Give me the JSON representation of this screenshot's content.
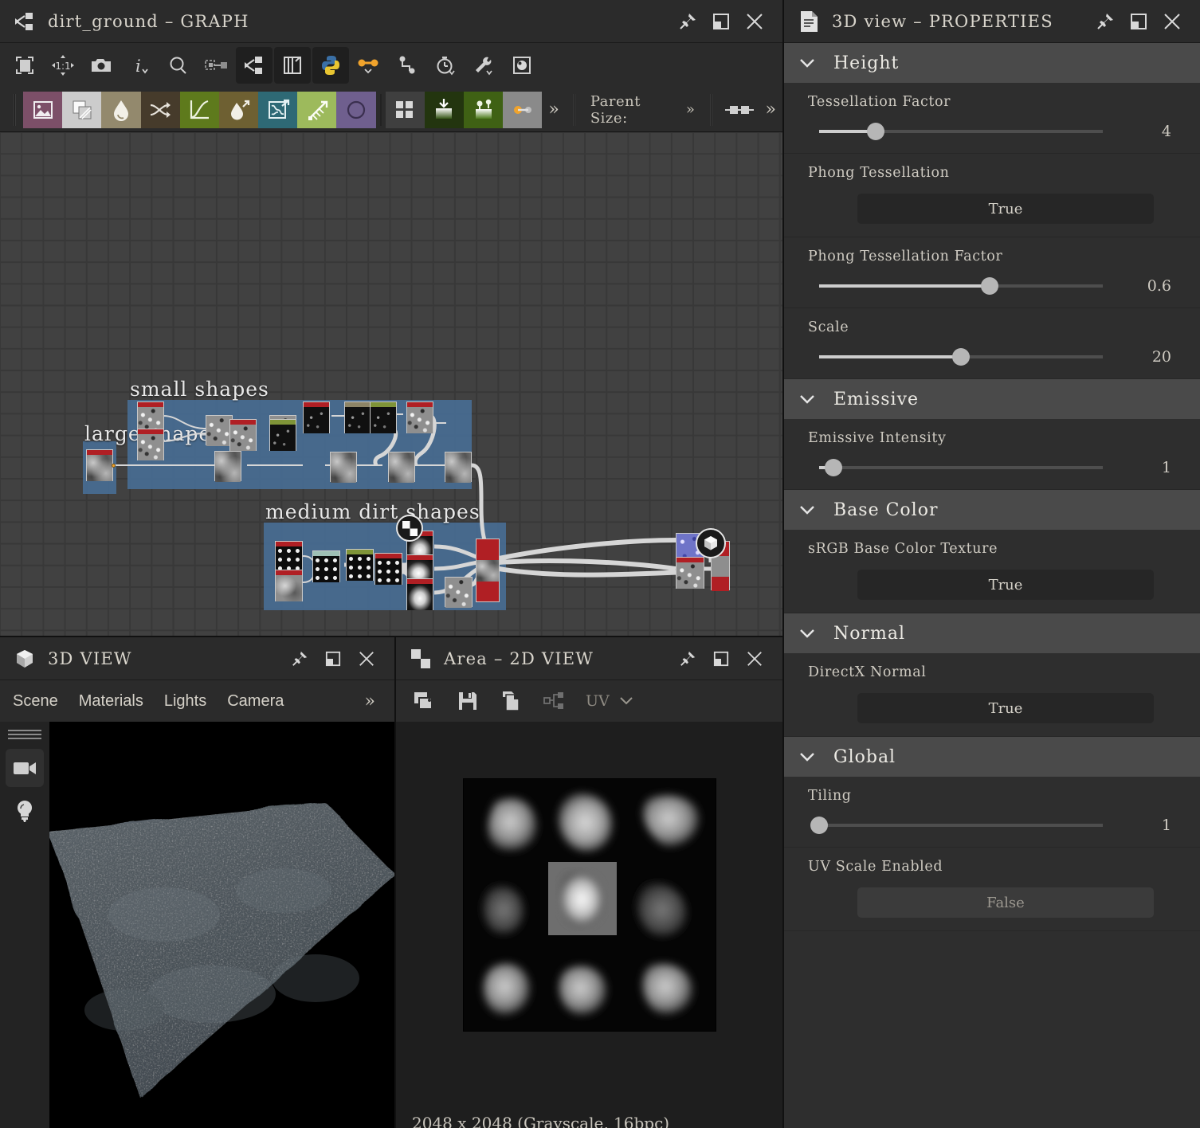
{
  "graph_panel": {
    "title": "dirt_ground – GRAPH",
    "title_icon": "graph-node-icon",
    "window_buttons": [
      "pin-icon",
      "maximize-icon",
      "close-icon"
    ],
    "toolbar_primary": [
      {
        "name": "fit-view-icon",
        "label": "Fit View"
      },
      {
        "name": "zoom-one-to-one-icon",
        "label": "1:1"
      },
      {
        "name": "camera-icon",
        "label": "Screenshot"
      },
      {
        "name": "info-icon",
        "label": "Info"
      },
      {
        "name": "search-icon",
        "label": "Search"
      },
      {
        "name": "link-node-icon",
        "label": "Link"
      },
      {
        "name": "graph-icon",
        "label": "Graph"
      },
      {
        "name": "copy-layers-icon",
        "label": "Layers"
      },
      {
        "name": "python-icon",
        "label": "Python"
      },
      {
        "name": "connection-icon",
        "label": "Connections"
      },
      {
        "name": "path-icon",
        "label": "Path"
      },
      {
        "name": "timer-icon",
        "label": "Timer"
      },
      {
        "name": "wrench-icon",
        "label": "Tools"
      },
      {
        "name": "material-preview-icon",
        "label": "Preview"
      }
    ],
    "toolbar_nodes": [
      {
        "name": "bitmap-node-icon",
        "color": "#7c4f68"
      },
      {
        "name": "blend-node-icon",
        "color": "#cccccc"
      },
      {
        "name": "blur-node-icon",
        "color": "#93896d"
      },
      {
        "name": "shuffle-node-icon",
        "color": "#463b2b"
      },
      {
        "name": "curve-node-icon",
        "color": "#5e7a1c"
      },
      {
        "name": "directional-blur-node-icon",
        "color": "#6e6032"
      },
      {
        "name": "warp-node-icon",
        "color": "#2e6975"
      },
      {
        "name": "gradient-node-icon",
        "color": "#9dba5c"
      },
      {
        "name": "shape-node-icon",
        "color": "#6f5f8e"
      },
      {
        "name": "tile-node-icon",
        "color": "#3f3f3f"
      },
      {
        "name": "input-node-icon",
        "color": "#23350f"
      },
      {
        "name": "output-node-icon",
        "color": "#3f6114"
      },
      {
        "name": "link-creation-node-icon",
        "color": "#8a8a8a"
      }
    ],
    "toolbar_overflow": "»",
    "parent_size_label": "Parent Size:",
    "parent_size_chevron": "»",
    "frames": [
      {
        "name": "small shapes",
        "color": "#486e96"
      },
      {
        "name": "large shapes",
        "color": "#486e96"
      },
      {
        "name": "medium dirt shapes",
        "color": "#486e96"
      }
    ]
  },
  "view3d_panel": {
    "title": "3D VIEW",
    "title_icon": "cube-icon",
    "window_buttons": [
      "pin-icon",
      "maximize-icon",
      "close-icon"
    ],
    "tabs": [
      "Scene",
      "Materials",
      "Lights",
      "Camera"
    ],
    "tabs_overflow": "»",
    "side_tools": [
      {
        "name": "camera-tool-icon",
        "active": true
      },
      {
        "name": "light-tool-icon",
        "active": false
      }
    ]
  },
  "view2d_panel": {
    "title": "Area – 2D VIEW",
    "title_icon": "checker-icon",
    "window_buttons": [
      "pin-icon",
      "maximize-icon",
      "close-icon"
    ],
    "toolbar": [
      {
        "name": "duplicate-view-icon"
      },
      {
        "name": "save-icon"
      },
      {
        "name": "copy-icon"
      },
      {
        "name": "graph-link-icon"
      }
    ],
    "uv_label": "UV",
    "uv_chevron": "chevron-down-icon",
    "status": "2048 x 2048 (Grayscale, 16bpc)"
  },
  "properties_panel": {
    "title": "3D view – PROPERTIES",
    "title_icon": "document-icon",
    "window_buttons": [
      "pin-icon",
      "maximize-icon",
      "close-icon"
    ],
    "groups": [
      {
        "name": "Height",
        "collapse_icon": "chevron-down-icon",
        "rows": [
          {
            "type": "slider",
            "label": "Tessellation Factor",
            "value": "4",
            "percent": 20
          },
          {
            "type": "combo",
            "label": "Phong Tessellation",
            "value": "True",
            "disabled": false
          },
          {
            "type": "slider",
            "label": "Phong Tessellation Factor",
            "value": "0.6",
            "percent": 60
          },
          {
            "type": "slider",
            "label": "Scale",
            "value": "20",
            "percent": 50
          }
        ]
      },
      {
        "name": "Emissive",
        "collapse_icon": "chevron-down-icon",
        "rows": [
          {
            "type": "slider",
            "label": "Emissive Intensity",
            "value": "1",
            "percent": 5
          }
        ]
      },
      {
        "name": "Base Color",
        "collapse_icon": "chevron-down-icon",
        "rows": [
          {
            "type": "combo",
            "label": "sRGB Base Color Texture",
            "value": "True",
            "disabled": false
          }
        ]
      },
      {
        "name": "Normal",
        "collapse_icon": "chevron-down-icon",
        "rows": [
          {
            "type": "combo",
            "label": "DirectX Normal",
            "value": "True",
            "disabled": false
          }
        ]
      },
      {
        "name": "Global",
        "collapse_icon": "chevron-down-icon",
        "rows": [
          {
            "type": "slider",
            "label": "Tiling",
            "value": "1",
            "percent": 0
          },
          {
            "type": "combo",
            "label": "UV Scale Enabled",
            "value": "False",
            "disabled": true
          }
        ]
      }
    ]
  },
  "colors": {
    "panel_bg": "#2e2e2e",
    "titlebar_bg": "#2b2b2b",
    "group_header_bg": "#4a4a4a",
    "graph_bg": "#414141",
    "frame_blue": "#486e96",
    "node_red_header": "#b01f24",
    "accent_orange": "#f0a32c",
    "text": "#cfcbc2"
  }
}
